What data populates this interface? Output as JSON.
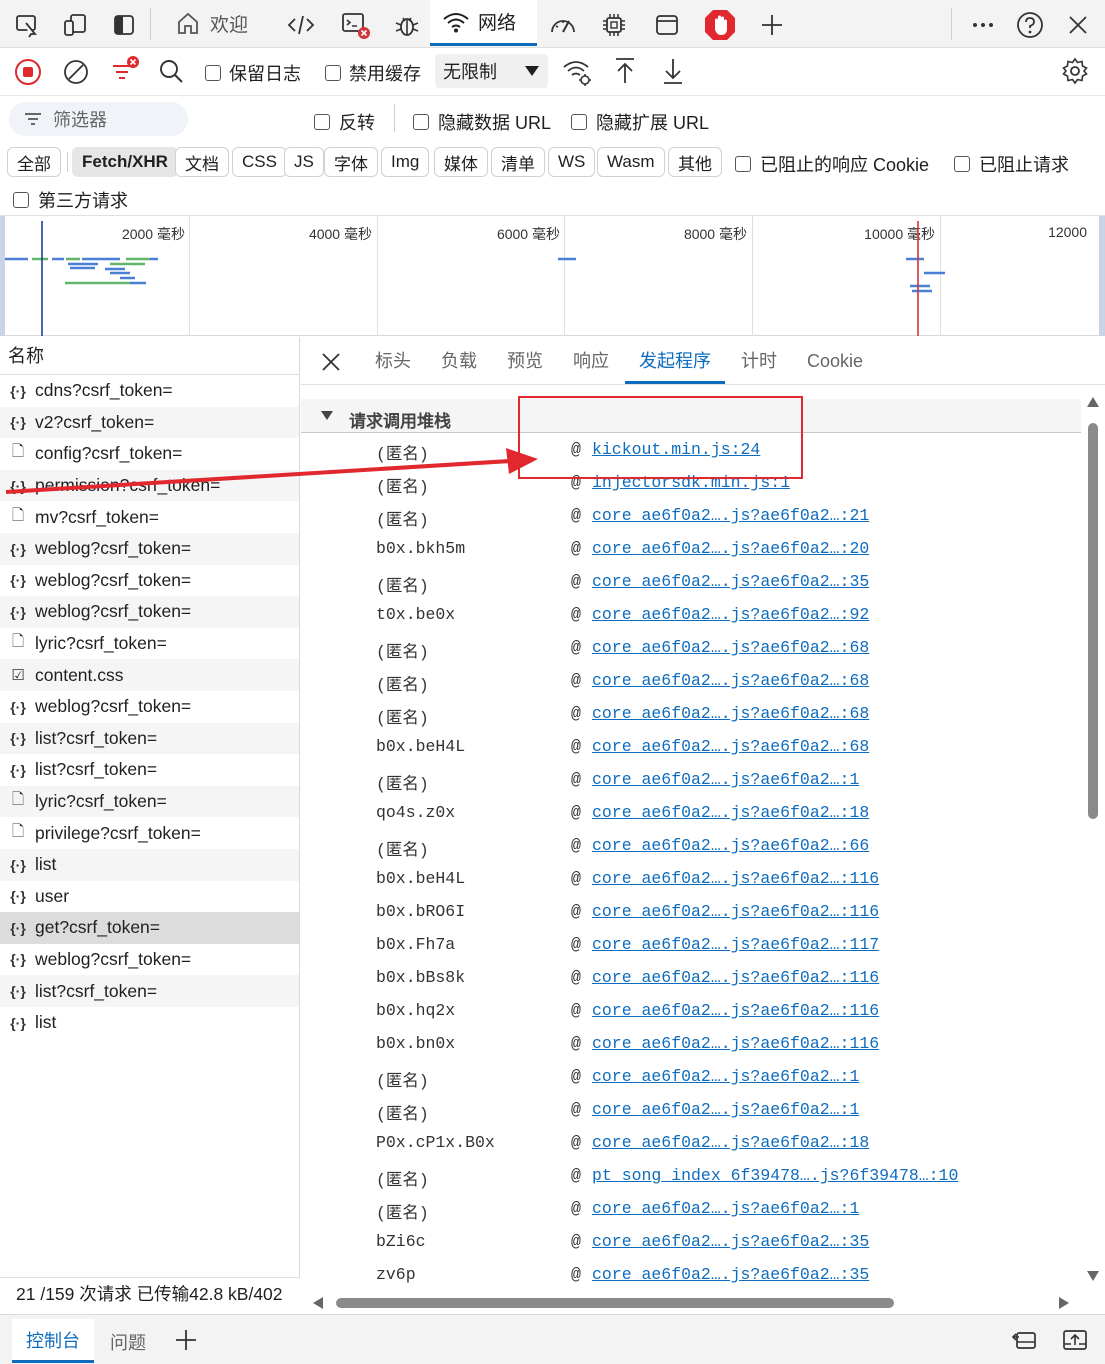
{
  "tabbar": {
    "welcome": "欢迎",
    "network": "网络"
  },
  "toolbar": {
    "preserve_log": "保留日志",
    "disable_cache": "禁用缓存",
    "throttle": "无限制"
  },
  "filters": {
    "placeholder": "筛选器",
    "invert": "反转",
    "hide_data_url": "隐藏数据 URL",
    "hide_ext_url": "隐藏扩展 URL",
    "types": [
      "全部",
      "Fetch/XHR",
      "文档",
      "CSS",
      "JS",
      "字体",
      "Img",
      "媒体",
      "清单",
      "WS",
      "Wasm",
      "其他"
    ],
    "blocked_cookies": "已阻止的响应 Cookie",
    "blocked_requests": "已阻止请求",
    "third_party": "第三方请求"
  },
  "overview": {
    "ticks": [
      "2000  毫秒",
      "4000  毫秒",
      "6000  毫秒",
      "8000  毫秒",
      "10000  毫秒",
      "12000"
    ]
  },
  "requests": {
    "header": "名称",
    "items": [
      {
        "name": "cdns?csrf_token=",
        "icon": "xhr-icon"
      },
      {
        "name": "v2?csrf_token=",
        "icon": "xhr-icon"
      },
      {
        "name": "config?csrf_token=",
        "icon": "doc-icon"
      },
      {
        "name": "permission?csrf_token=",
        "icon": "xhr-icon"
      },
      {
        "name": "mv?csrf_token=",
        "icon": "doc-icon"
      },
      {
        "name": "weblog?csrf_token=",
        "icon": "xhr-icon"
      },
      {
        "name": "weblog?csrf_token=",
        "icon": "xhr-icon"
      },
      {
        "name": "weblog?csrf_token=",
        "icon": "xhr-icon"
      },
      {
        "name": "lyric?csrf_token=",
        "icon": "doc-icon"
      },
      {
        "name": "content.css",
        "icon": "css-icon"
      },
      {
        "name": "weblog?csrf_token=",
        "icon": "xhr-icon"
      },
      {
        "name": "list?csrf_token=",
        "icon": "xhr-icon"
      },
      {
        "name": "list?csrf_token=",
        "icon": "xhr-icon"
      },
      {
        "name": "lyric?csrf_token=",
        "icon": "doc-icon"
      },
      {
        "name": "privilege?csrf_token=",
        "icon": "doc-icon"
      },
      {
        "name": "list",
        "icon": "xhr-icon"
      },
      {
        "name": "user",
        "icon": "xhr-icon"
      },
      {
        "name": "get?csrf_token=",
        "icon": "xhr-icon"
      },
      {
        "name": "weblog?csrf_token=",
        "icon": "xhr-icon"
      },
      {
        "name": "list?csrf_token=",
        "icon": "xhr-icon"
      },
      {
        "name": "list",
        "icon": "xhr-icon"
      }
    ],
    "status": "21 /159 次请求  已传输42.8 kB/402"
  },
  "detail": {
    "tabs": [
      "标头",
      "负载",
      "预览",
      "响应",
      "发起程序",
      "计时",
      "Cookie"
    ],
    "section_title": "请求调用堆栈",
    "stack": [
      {
        "fn": "(匿名)",
        "src": "kickout.min.js:24"
      },
      {
        "fn": "(匿名)",
        "src": "injectorsdk.min.js:1"
      },
      {
        "fn": "(匿名)",
        "src": "core_ae6f0a2….js?ae6f0a2…:21"
      },
      {
        "fn": "b0x.bkh5m",
        "src": "core_ae6f0a2….js?ae6f0a2…:20"
      },
      {
        "fn": "(匿名)",
        "src": "core_ae6f0a2….js?ae6f0a2…:35"
      },
      {
        "fn": "t0x.be0x",
        "src": "core_ae6f0a2….js?ae6f0a2…:92"
      },
      {
        "fn": "(匿名)",
        "src": "core_ae6f0a2….js?ae6f0a2…:68"
      },
      {
        "fn": "(匿名)",
        "src": "core_ae6f0a2….js?ae6f0a2…:68"
      },
      {
        "fn": "(匿名)",
        "src": "core_ae6f0a2….js?ae6f0a2…:68"
      },
      {
        "fn": "b0x.beH4L",
        "src": "core_ae6f0a2….js?ae6f0a2…:68"
      },
      {
        "fn": "(匿名)",
        "src": "core_ae6f0a2….js?ae6f0a2…:1"
      },
      {
        "fn": "qo4s.z0x",
        "src": "core_ae6f0a2….js?ae6f0a2…:18"
      },
      {
        "fn": "(匿名)",
        "src": "core_ae6f0a2….js?ae6f0a2…:66"
      },
      {
        "fn": "b0x.beH4L",
        "src": "core_ae6f0a2….js?ae6f0a2…:116"
      },
      {
        "fn": "b0x.bRO6I",
        "src": "core_ae6f0a2….js?ae6f0a2…:116"
      },
      {
        "fn": "b0x.Fh7a",
        "src": "core_ae6f0a2….js?ae6f0a2…:117"
      },
      {
        "fn": "b0x.bBs8k",
        "src": "core_ae6f0a2….js?ae6f0a2…:116"
      },
      {
        "fn": "b0x.hq2x",
        "src": "core_ae6f0a2….js?ae6f0a2…:116"
      },
      {
        "fn": "b0x.bn0x",
        "src": "core_ae6f0a2….js?ae6f0a2…:116"
      },
      {
        "fn": "(匿名)",
        "src": "core_ae6f0a2….js?ae6f0a2…:1"
      },
      {
        "fn": "(匿名)",
        "src": "core_ae6f0a2….js?ae6f0a2…:1"
      },
      {
        "fn": "P0x.cP1x.B0x",
        "src": "core_ae6f0a2….js?ae6f0a2…:18"
      },
      {
        "fn": "(匿名)",
        "src": "pt_song_index_6f39478….js?6f39478…:10"
      },
      {
        "fn": "(匿名)",
        "src": "core_ae6f0a2….js?ae6f0a2…:1"
      },
      {
        "fn": "bZi6c",
        "src": "core_ae6f0a2….js?ae6f0a2…:35"
      },
      {
        "fn": "zv6p",
        "src": "core_ae6f0a2….js?ae6f0a2…:35"
      }
    ],
    "at": "@"
  },
  "drawer": {
    "console": "控制台",
    "issues": "问题"
  },
  "colors": {
    "accent": "#0f6cbd",
    "annotation": "#e0282e",
    "record": "#e0282e"
  }
}
